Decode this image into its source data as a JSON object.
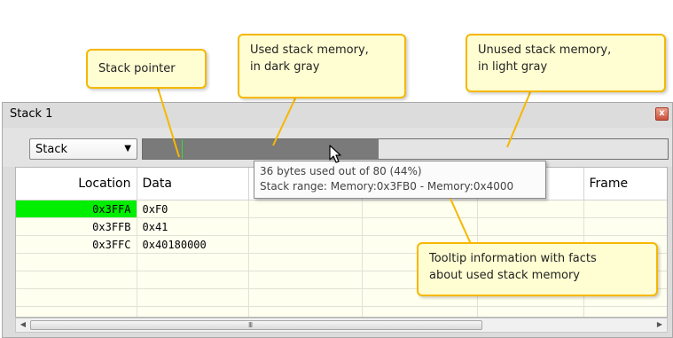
{
  "window": {
    "title": "Stack 1",
    "close_label": "x"
  },
  "toolbar": {
    "view_select": {
      "value": "Stack",
      "arrow": "▼"
    },
    "usage_bar": {
      "used_bytes": 36,
      "total_bytes": 80,
      "stack_pointer_fraction": 0.075,
      "colors": {
        "used": "#7a7a7a",
        "unused": "#e4e4e4",
        "stack_pointer": "#33dd33"
      }
    }
  },
  "table": {
    "columns": [
      "Location",
      "Data",
      "",
      "",
      "",
      "Frame"
    ],
    "rows": [
      {
        "location": "0x3FFA",
        "data": "0xF0",
        "highlighted": true
      },
      {
        "location": "0x3FFB",
        "data": "0x41",
        "highlighted": false
      },
      {
        "location": "0x3FFC",
        "data": "0x40180000",
        "highlighted": false
      }
    ],
    "empty_rows": 4,
    "highlight_color": "#00ee00"
  },
  "scrollbar": {
    "left_arrow": "◀",
    "right_arrow": "▶",
    "grip": "III"
  },
  "tooltip": {
    "line1": "36 bytes used out of 80 (44%)",
    "line2": "Stack range: Memory:0x3FB0 - Memory:0x4000"
  },
  "callouts": {
    "stack_pointer": "Stack pointer",
    "used_line1": "Used stack memory,",
    "used_line2": "in dark gray",
    "unused_line1": "Unused stack memory,",
    "unused_line2": "in light gray",
    "tooltip_line1": "Tooltip information with facts",
    "tooltip_line2": "about used stack memory",
    "border_color": "#f5b800",
    "fill_color": "#fffed2"
  }
}
